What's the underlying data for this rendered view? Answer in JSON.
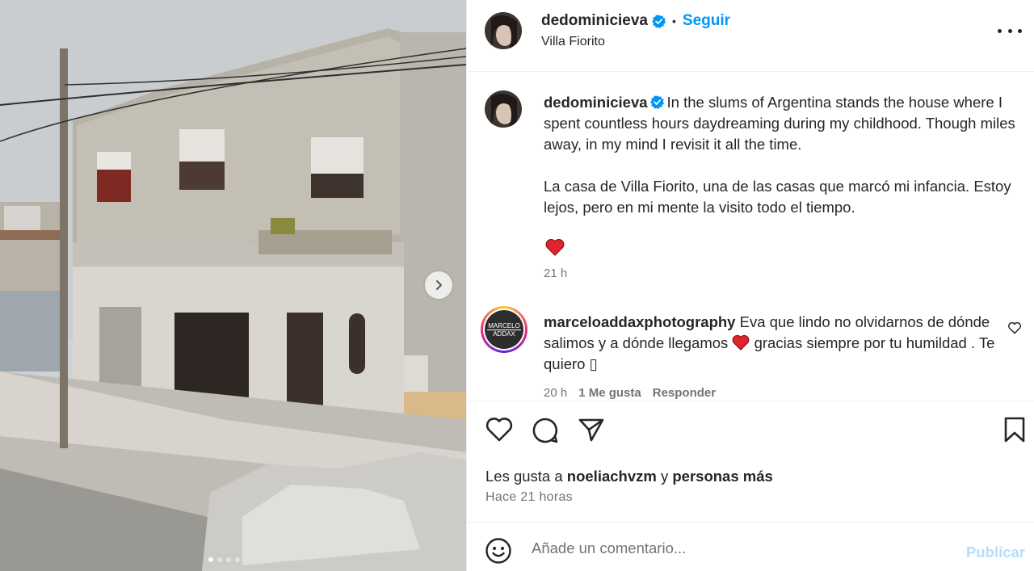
{
  "post": {
    "username": "dedominicieva",
    "separator": "•",
    "follow_label": "Seguir",
    "location": "Villa Fiorito"
  },
  "caption": {
    "username": "dedominicieva",
    "text_en": "In the slums of Argentina stands the house where I spent countless hours daydreaming during my childhood. Though miles away, in my mind I revisit it all the time.",
    "text_es": "La casa de Villa Fiorito, una de las casas que marcó mi infancia. Estoy lejos, pero en mi mente la visito todo el tiempo.",
    "emoji": "heart",
    "time": "21 h"
  },
  "comment": {
    "username": "marceloaddaxphotography",
    "text_a": "Eva que lindo no olvidarnos de dónde salimos y a dónde llegamos",
    "text_b": "gracias siempre por tu humildad . Te quiero",
    "trailing_glyph": "▯",
    "avatar_line1": "MARCELO",
    "avatar_line2": "ADDAX",
    "time": "20 h",
    "likes": "1 Me gusta",
    "reply": "Responder"
  },
  "likes": {
    "prefix": "Les gusta a",
    "user": "noeliachvzm",
    "conjunction": "y",
    "suffix": "personas más"
  },
  "timestamp": "Hace 21 horas",
  "composer": {
    "placeholder": "Añade un comentario...",
    "publish_label": "Publicar"
  },
  "carousel": {
    "total": 4,
    "active_index": 0
  },
  "colors": {
    "accent": "#0095f6",
    "publish_disabled": "#b2dffc",
    "muted": "#737373",
    "heart": "#ed4956"
  }
}
